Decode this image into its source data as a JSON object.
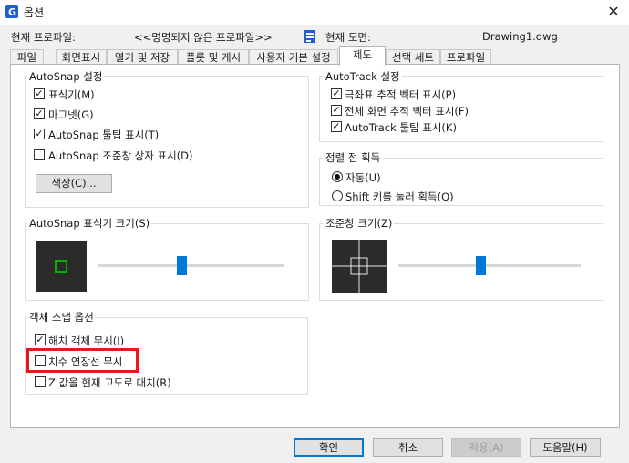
{
  "window": {
    "title": "옵션",
    "app_icon": "app-logo-icon",
    "close_glyph": "✕"
  },
  "profile_row": {
    "current_profile_label": "현재 프로파일:",
    "current_profile_value": "<<명명되지 않은 프로파일>>",
    "current_drawing_label": "현재 도면:",
    "current_drawing_value": "Drawing1.dwg"
  },
  "tabs": [
    {
      "label": "파일"
    },
    {
      "label": "화면표시"
    },
    {
      "label": "열기 및 저장"
    },
    {
      "label": "플롯 및 게시"
    },
    {
      "label": "사용자 기본 설정"
    },
    {
      "label": "제도",
      "active": true
    },
    {
      "label": "선택 세트"
    },
    {
      "label": "프로파일"
    }
  ],
  "autosnap": {
    "title": "AutoSnap 설정",
    "items": [
      {
        "label": "표식기(M)",
        "checked": true
      },
      {
        "label": "마그넷(G)",
        "checked": true
      },
      {
        "label": "AutoSnap 툴팁 표시(T)",
        "checked": true
      },
      {
        "label": "AutoSnap 조준창 상자 표시(D)",
        "checked": false
      }
    ],
    "color_button": "색상(C)..."
  },
  "autotrack": {
    "title": "AutoTrack 설정",
    "items": [
      {
        "label": "극좌표 추적 벡터 표시(P)",
        "checked": true
      },
      {
        "label": "전체 화면 추적 벡터 표시(F)",
        "checked": true
      },
      {
        "label": "AutoTrack 툴팁 표시(K)",
        "checked": true
      }
    ]
  },
  "alignment": {
    "title": "정렬 점 획득",
    "options": [
      {
        "label": "자동(U)",
        "selected": true
      },
      {
        "label": "Shift 키를 눌러 획득(Q)",
        "selected": false
      }
    ]
  },
  "marker_size": {
    "title": "AutoSnap 표식기 크기(S)",
    "value_fraction": 0.45
  },
  "aperture_size": {
    "title": "조준창 크기(Z)",
    "value_fraction": 0.45
  },
  "object_snap": {
    "title": "객체 스냅 옵션",
    "items": [
      {
        "label": "해치 객체 무시(I)",
        "checked": true
      },
      {
        "label": "치수 연장선 무시",
        "checked": false,
        "highlighted": true
      },
      {
        "label": "Z 값을 현재 고도로 대치(R)",
        "checked": false
      }
    ]
  },
  "footer": {
    "ok": "확인",
    "cancel": "취소",
    "apply": "적용(A)",
    "help": "도움말(H)"
  },
  "colors": {
    "accent": "#0078d7",
    "highlight": "#e8191b",
    "marker": "#00b400"
  }
}
